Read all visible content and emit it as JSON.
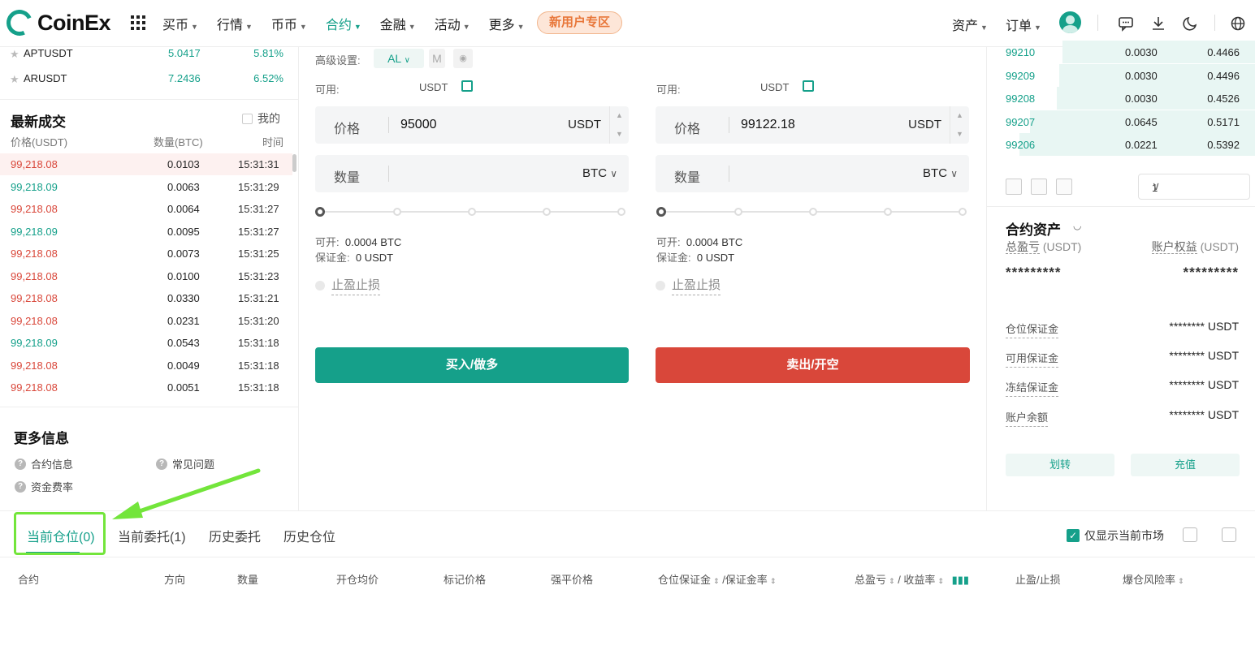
{
  "header": {
    "logo_text": "CoinEx",
    "nav": [
      {
        "label": "买币",
        "active": false
      },
      {
        "label": "行情",
        "active": false
      },
      {
        "label": "币币",
        "active": false
      },
      {
        "label": "合约",
        "active": true
      },
      {
        "label": "金融",
        "active": false
      },
      {
        "label": "活动",
        "active": false
      },
      {
        "label": "更多",
        "active": false
      }
    ],
    "promo": "新用户专区",
    "assets": "资产",
    "orders": "订单"
  },
  "markets": [
    {
      "symbol": "APTUSDT",
      "price": "5.0417",
      "change": "5.81%"
    },
    {
      "symbol": "ARUSDT",
      "price": "7.2436",
      "change": "6.52%"
    }
  ],
  "trades": {
    "title": "最新成交",
    "mine": "我的",
    "col_price": "价格(USDT)",
    "col_qty": "数量(BTC)",
    "col_time": "时间",
    "rows": [
      {
        "price": "99,218.08",
        "qty": "0.0103",
        "time": "15:31:31",
        "side": "red"
      },
      {
        "price": "99,218.09",
        "qty": "0.0063",
        "time": "15:31:29",
        "side": "green"
      },
      {
        "price": "99,218.08",
        "qty": "0.0064",
        "time": "15:31:27",
        "side": "red"
      },
      {
        "price": "99,218.09",
        "qty": "0.0095",
        "time": "15:31:27",
        "side": "green"
      },
      {
        "price": "99,218.08",
        "qty": "0.0073",
        "time": "15:31:25",
        "side": "red"
      },
      {
        "price": "99,218.08",
        "qty": "0.0100",
        "time": "15:31:23",
        "side": "red"
      },
      {
        "price": "99,218.08",
        "qty": "0.0330",
        "time": "15:31:21",
        "side": "red"
      },
      {
        "price": "99,218.08",
        "qty": "0.0231",
        "time": "15:31:20",
        "side": "red"
      },
      {
        "price": "99,218.09",
        "qty": "0.0543",
        "time": "15:31:18",
        "side": "green"
      },
      {
        "price": "99,218.08",
        "qty": "0.0049",
        "time": "15:31:18",
        "side": "red"
      },
      {
        "price": "99,218.08",
        "qty": "0.0051",
        "time": "15:31:18",
        "side": "red"
      }
    ]
  },
  "more_info": {
    "title": "更多信息",
    "contract_info": "合约信息",
    "faq": "常见问题",
    "funding_rate": "资金费率"
  },
  "order_form": {
    "advanced": "高级设置:",
    "mode_chip": "AL",
    "m_chip": "M",
    "buy": {
      "avail_label": "可用:",
      "avail_unit": "USDT",
      "price_label": "价格",
      "price_value": "95000",
      "price_unit": "USDT",
      "qty_label": "数量",
      "qty_unit": "BTC",
      "open_label": "可开:",
      "open_value": "0.0004 BTC",
      "margin_label": "保证金:",
      "margin_value": "0 USDT",
      "tpsl": "止盈止损",
      "button": "买入/做多"
    },
    "sell": {
      "avail_label": "可用:",
      "avail_unit": "USDT",
      "price_label": "价格",
      "price_value": "99122.18",
      "price_unit": "USDT",
      "qty_label": "数量",
      "qty_unit": "BTC",
      "open_label": "可开:",
      "open_value": "0.0004 BTC",
      "margin_label": "保证金:",
      "margin_value": "0 USDT",
      "tpsl": "止盈止损",
      "button": "卖出/开空"
    }
  },
  "orderbook": {
    "rows": [
      {
        "price": "99210",
        "qty": "0.0030",
        "sum": "0.4466",
        "fill": 0.72
      },
      {
        "price": "99209",
        "qty": "0.0030",
        "sum": "0.4496",
        "fill": 0.73
      },
      {
        "price": "99208",
        "qty": "0.0030",
        "sum": "0.4526",
        "fill": 0.74
      },
      {
        "price": "99207",
        "qty": "0.0645",
        "sum": "0.5171",
        "fill": 0.84
      },
      {
        "price": "99206",
        "qty": "0.0221",
        "sum": "0.5392",
        "fill": 0.88
      }
    ],
    "depth_value": "1"
  },
  "contract_assets": {
    "title": "合约资产",
    "pnl_label": "总盈亏",
    "pnl_unit": "(USDT)",
    "equity_label": "账户权益",
    "equity_unit": "(USDT)",
    "masked": "*********",
    "rows": [
      {
        "label": "仓位保证金",
        "value": "******** USDT"
      },
      {
        "label": "可用保证金",
        "value": "******** USDT"
      },
      {
        "label": "冻结保证金",
        "value": "******** USDT"
      },
      {
        "label": "账户余额",
        "value": "******** USDT"
      }
    ],
    "transfer": "划转",
    "deposit": "充值"
  },
  "bottom": {
    "tabs": [
      "当前仓位(0)",
      "当前委托(1)",
      "历史委托",
      "历史仓位"
    ],
    "only_current": "仅显示当前市场",
    "columns": {
      "contract": "合约",
      "direction": "方向",
      "qty": "数量",
      "entry": "开仓均价",
      "mark": "标记价格",
      "liq": "强平价格",
      "margin": "仓位保证金",
      "margin_rate": "/保证金率",
      "pnl": "总盈亏",
      "roe": "/ 收益率",
      "tpsl": "止盈/止损",
      "risk": "爆仓风险率"
    }
  },
  "colors": {
    "accent": "#15a08a",
    "sell": "#d9473a",
    "highlight": "#73e53b"
  }
}
